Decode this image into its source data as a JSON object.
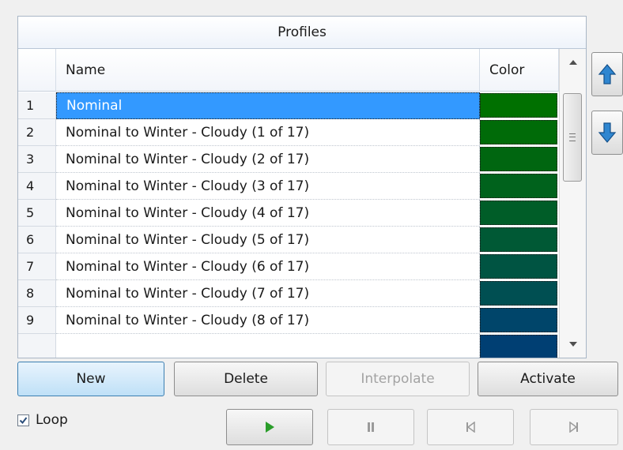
{
  "grid": {
    "title": "Profiles",
    "columns": {
      "row_header": "",
      "name": "Name",
      "color": "Color"
    },
    "selected_row": 1,
    "rows": [
      {
        "num": "1",
        "name": "Nominal",
        "color": "#007000"
      },
      {
        "num": "2",
        "name": "Nominal to Winter - Cloudy (1 of 17)",
        "color": "#006b08"
      },
      {
        "num": "3",
        "name": "Nominal to Winter - Cloudy (2 of 17)",
        "color": "#006610"
      },
      {
        "num": "4",
        "name": "Nominal to Winter - Cloudy (3 of 17)",
        "color": "#00621c"
      },
      {
        "num": "5",
        "name": "Nominal to Winter - Cloudy (4 of 17)",
        "color": "#005d28"
      },
      {
        "num": "6",
        "name": "Nominal to Winter - Cloudy (5 of 17)",
        "color": "#005935"
      },
      {
        "num": "7",
        "name": "Nominal to Winter - Cloudy (6 of 17)",
        "color": "#005442"
      },
      {
        "num": "8",
        "name": "Nominal to Winter - Cloudy (7 of 17)",
        "color": "#004f52"
      },
      {
        "num": "9",
        "name": "Nominal to Winter - Cloudy (8 of 17)",
        "color": "#00456a"
      }
    ]
  },
  "buttons": {
    "new": "New",
    "delete": "Delete",
    "interpolate": "Interpolate",
    "activate": "Activate"
  },
  "loop": {
    "label": "Loop",
    "checked": true
  },
  "icons": {
    "move_up": "arrow-up-icon",
    "move_down": "arrow-down-icon",
    "play": "play-icon",
    "pause": "pause-icon",
    "skip_start": "skip-to-start-icon",
    "skip_end": "skip-to-end-icon"
  },
  "colors": {
    "selection": "#3399ff",
    "side_arrow": "#2f86d0",
    "play": "#2a9d2a"
  }
}
